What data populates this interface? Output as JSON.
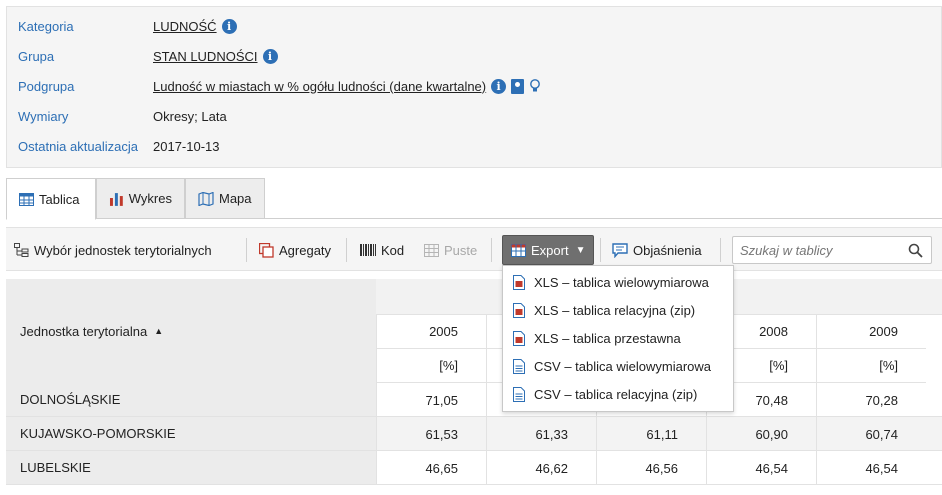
{
  "meta": {
    "rows": [
      {
        "label": "Kategoria",
        "value": "LUDNOŚĆ"
      },
      {
        "label": "Grupa",
        "value": "STAN LUDNOŚCI"
      },
      {
        "label": "Podgrupa",
        "value": "Ludność w miastach w % ogółu ludności (dane kwartalne)"
      },
      {
        "label": "Wymiary",
        "value": "Okresy; Lata"
      },
      {
        "label": "Ostatnia aktualizacja",
        "value": "2017-10-13"
      }
    ]
  },
  "tabs": [
    {
      "label": "Tablica",
      "active": true
    },
    {
      "label": "Wykres",
      "active": false
    },
    {
      "label": "Mapa",
      "active": false
    }
  ],
  "toolbar": {
    "units_label": "Wybór jednostek terytorialnych",
    "aggregates_label": "Agregaty",
    "code_label": "Kod",
    "empty_label": "Puste",
    "export_label": "Export",
    "explanations_label": "Objaśnienia",
    "search_placeholder": "Szukaj w tablicy"
  },
  "export_menu": [
    "XLS – tablica wielowymiarowa",
    "XLS – tablica relacyjna (zip)",
    "XLS – tablica przestawna",
    "CSV – tablica wielowymiarowa",
    "CSV – tablica relacyjna (zip)"
  ],
  "table": {
    "unit_header": "Jednostka terytorialna",
    "years": [
      "2005",
      "",
      "",
      "2008",
      "2009"
    ],
    "units": [
      "[%]",
      "",
      "",
      "[%]",
      "[%]"
    ],
    "rows": [
      {
        "name": "DOLNOŚLĄSKIE",
        "values": [
          "71,05",
          "",
          "",
          "70,48",
          "70,28"
        ]
      },
      {
        "name": "KUJAWSKO-POMORSKIE",
        "values": [
          "61,53",
          "61,33",
          "61,11",
          "60,90",
          "60,74"
        ]
      },
      {
        "name": "LUBELSKIE",
        "values": [
          "46,65",
          "46,62",
          "46,56",
          "46,54",
          "46,54"
        ]
      }
    ]
  },
  "colors": {
    "link_blue": "#2d6fb5",
    "export_bg": "#6f6f6f",
    "xls_red": "#c0392b",
    "csv_blue": "#2d6fb5"
  }
}
